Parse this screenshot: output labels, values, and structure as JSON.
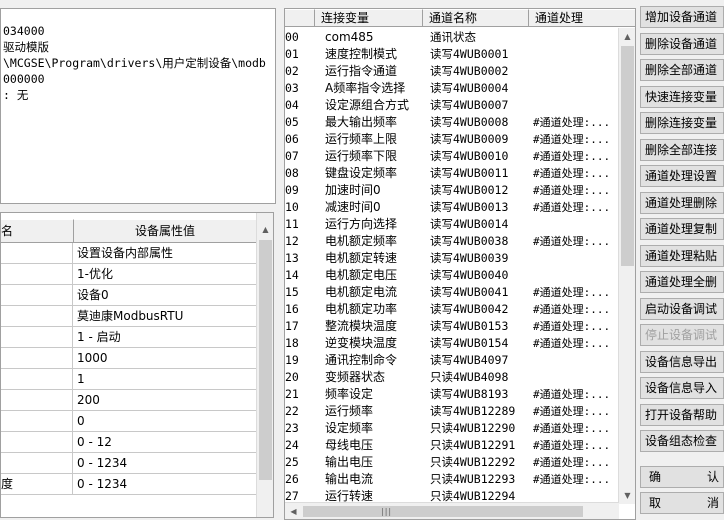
{
  "info_lines": [
    "034000",
    "驱动模版",
    "\\MCGSE\\Program\\drivers\\用户定制设备\\modb",
    "000000",
    ": 无"
  ],
  "property_grid": {
    "header_name": "名",
    "header_value": "设备属性值",
    "rows": [
      {
        "name": "",
        "value": "设置设备内部属性"
      },
      {
        "name": "",
        "value": "1-优化"
      },
      {
        "name": "",
        "value": "设备0"
      },
      {
        "name": "",
        "value": "莫迪康ModbusRTU"
      },
      {
        "name": "",
        "value": "1 - 启动"
      },
      {
        "name": "",
        "value": "1000"
      },
      {
        "name": "",
        "value": "1"
      },
      {
        "name": "",
        "value": "200"
      },
      {
        "name": "",
        "value": "0"
      },
      {
        "name": "",
        "value": "0 - 12"
      },
      {
        "name": "",
        "value": "0 - 1234"
      },
      {
        "name": "度",
        "value": "0 - 1234"
      }
    ]
  },
  "channel_table": {
    "columns": [
      "连接变量",
      "通道名称",
      "通道处理"
    ],
    "rows": [
      {
        "idx": "00",
        "var": "com485",
        "ch": "通讯状态",
        "proc": ""
      },
      {
        "idx": "01",
        "var": "速度控制模式",
        "ch": "读写4WUB0001",
        "proc": ""
      },
      {
        "idx": "02",
        "var": "运行指令通道",
        "ch": "读写4WUB0002",
        "proc": ""
      },
      {
        "idx": "03",
        "var": "A频率指令选择",
        "ch": "读写4WUB0004",
        "proc": ""
      },
      {
        "idx": "04",
        "var": "设定源组合方式",
        "ch": "读写4WUB0007",
        "proc": ""
      },
      {
        "idx": "05",
        "var": "最大输出频率",
        "ch": "读写4WUB0008",
        "proc": "#通道处理:..."
      },
      {
        "idx": "06",
        "var": "运行频率上限",
        "ch": "读写4WUB0009",
        "proc": "#通道处理:..."
      },
      {
        "idx": "07",
        "var": "运行频率下限",
        "ch": "读写4WUB0010",
        "proc": "#通道处理:..."
      },
      {
        "idx": "08",
        "var": "键盘设定频率",
        "ch": "读写4WUB0011",
        "proc": "#通道处理:..."
      },
      {
        "idx": "09",
        "var": "加速时间0",
        "ch": "读写4WUB0012",
        "proc": "#通道处理:..."
      },
      {
        "idx": "10",
        "var": "减速时间0",
        "ch": "读写4WUB0013",
        "proc": "#通道处理:..."
      },
      {
        "idx": "11",
        "var": "运行方向选择",
        "ch": "读写4WUB0014",
        "proc": ""
      },
      {
        "idx": "12",
        "var": "电机额定频率",
        "ch": "读写4WUB0038",
        "proc": "#通道处理:..."
      },
      {
        "idx": "13",
        "var": "电机额定转速",
        "ch": "读写4WUB0039",
        "proc": ""
      },
      {
        "idx": "14",
        "var": "电机额定电压",
        "ch": "读写4WUB0040",
        "proc": ""
      },
      {
        "idx": "15",
        "var": "电机额定电流",
        "ch": "读写4WUB0041",
        "proc": "#通道处理:..."
      },
      {
        "idx": "16",
        "var": "电机额定功率",
        "ch": "读写4WUB0042",
        "proc": "#通道处理:..."
      },
      {
        "idx": "17",
        "var": "整流模块温度",
        "ch": "读写4WUB0153",
        "proc": "#通道处理:..."
      },
      {
        "idx": "18",
        "var": "逆变模块温度",
        "ch": "读写4WUB0154",
        "proc": "#通道处理:..."
      },
      {
        "idx": "19",
        "var": "通讯控制命令",
        "ch": "读写4WUB4097",
        "proc": ""
      },
      {
        "idx": "20",
        "var": "变频器状态",
        "ch": "只读4WUB4098",
        "proc": ""
      },
      {
        "idx": "21",
        "var": "频率设定",
        "ch": "读写4WUB8193",
        "proc": "#通道处理:..."
      },
      {
        "idx": "22",
        "var": "运行频率",
        "ch": "读写4WUB12289",
        "proc": "#通道处理:..."
      },
      {
        "idx": "23",
        "var": "设定频率",
        "ch": "只读4WUB12290",
        "proc": "#通道处理:..."
      },
      {
        "idx": "24",
        "var": "母线电压",
        "ch": "只读4WUB12291",
        "proc": "#通道处理:..."
      },
      {
        "idx": "25",
        "var": "输出电压",
        "ch": "只读4WUB12292",
        "proc": "#通道处理:..."
      },
      {
        "idx": "26",
        "var": "输出电流",
        "ch": "只读4WUB12293",
        "proc": "#通道处理:..."
      },
      {
        "idx": "27",
        "var": "运行转速",
        "ch": "只读4WUB12294",
        "proc": ""
      }
    ]
  },
  "buttons": [
    {
      "label": "增加设备通道",
      "enabled": true
    },
    {
      "label": "删除设备通道",
      "enabled": true
    },
    {
      "label": "删除全部通道",
      "enabled": true
    },
    {
      "label": "快速连接变量",
      "enabled": true
    },
    {
      "label": "删除连接变量",
      "enabled": true
    },
    {
      "label": "删除全部连接",
      "enabled": true
    },
    {
      "label": "通道处理设置",
      "enabled": true
    },
    {
      "label": "通道处理删除",
      "enabled": true
    },
    {
      "label": "通道处理复制",
      "enabled": true
    },
    {
      "label": "通道处理粘贴",
      "enabled": true
    },
    {
      "label": "通道处理全删",
      "enabled": true
    },
    {
      "label": "启动设备调试",
      "enabled": true
    },
    {
      "label": "停止设备调试",
      "enabled": false
    },
    {
      "label": "设备信息导出",
      "enabled": true
    },
    {
      "label": "设备信息导入",
      "enabled": true
    },
    {
      "label": "打开设备帮助",
      "enabled": true
    },
    {
      "label": "设备组态检查",
      "enabled": true
    }
  ],
  "confirm_button": {
    "left": "确",
    "right": "认"
  },
  "cancel_button": {
    "left": "取",
    "right": "消"
  }
}
